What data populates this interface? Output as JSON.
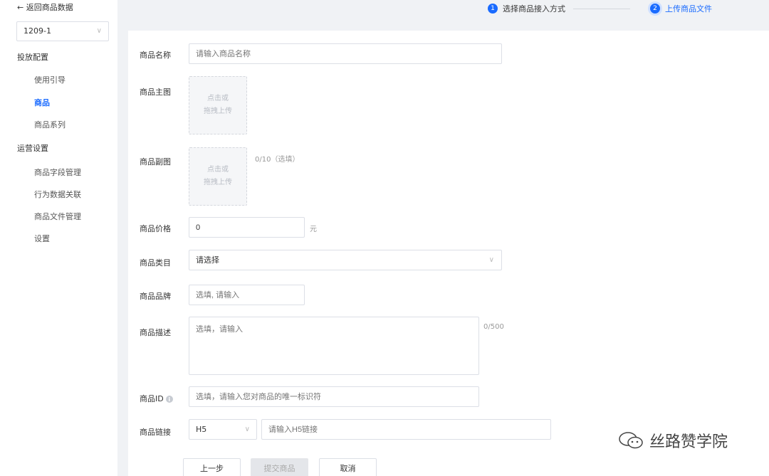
{
  "sidebar": {
    "back_label": "← 返回商品数据",
    "project_value": "1209-1",
    "sections": [
      {
        "title": "投放配置",
        "items": [
          "使用引导",
          "商品",
          "商品系列"
        ]
      },
      {
        "title": "运营设置",
        "items": [
          "商品字段管理",
          "行为数据关联",
          "商品文件管理",
          "设置"
        ]
      }
    ],
    "active_item": "商品"
  },
  "stepper": {
    "steps": [
      {
        "num": "1",
        "label": "选择商品接入方式"
      },
      {
        "num": "2",
        "label": "上传商品文件"
      }
    ]
  },
  "form": {
    "name_label": "商品名称",
    "name_placeholder": "请输入商品名称",
    "main_image_label": "商品主图",
    "upload_line1": "点击或",
    "upload_line2": "拖拽上传",
    "sub_image_label": "商品副图",
    "sub_image_hint": "0/10（选填）",
    "price_label": "商品价格",
    "price_value": "0",
    "price_unit": "元",
    "category_label": "商品类目",
    "category_value": "请选择",
    "brand_label": "商品品牌",
    "brand_placeholder": "选填, 请输入",
    "desc_label": "商品描述",
    "desc_placeholder": "选填，请输入",
    "desc_count": "0/500",
    "id_label": "商品ID",
    "id_placeholder": "选填，请输入您对商品的唯一标识符",
    "link_label": "商品链接",
    "link_type": "H5",
    "link_placeholder": "请输入H5链接"
  },
  "actions": {
    "prev_label": "上一步",
    "submit_label": "提交商品",
    "cancel_label": "取消"
  },
  "watermark": {
    "text": "丝路赞学院"
  },
  "colors": {
    "accent": "#1a6bff"
  }
}
